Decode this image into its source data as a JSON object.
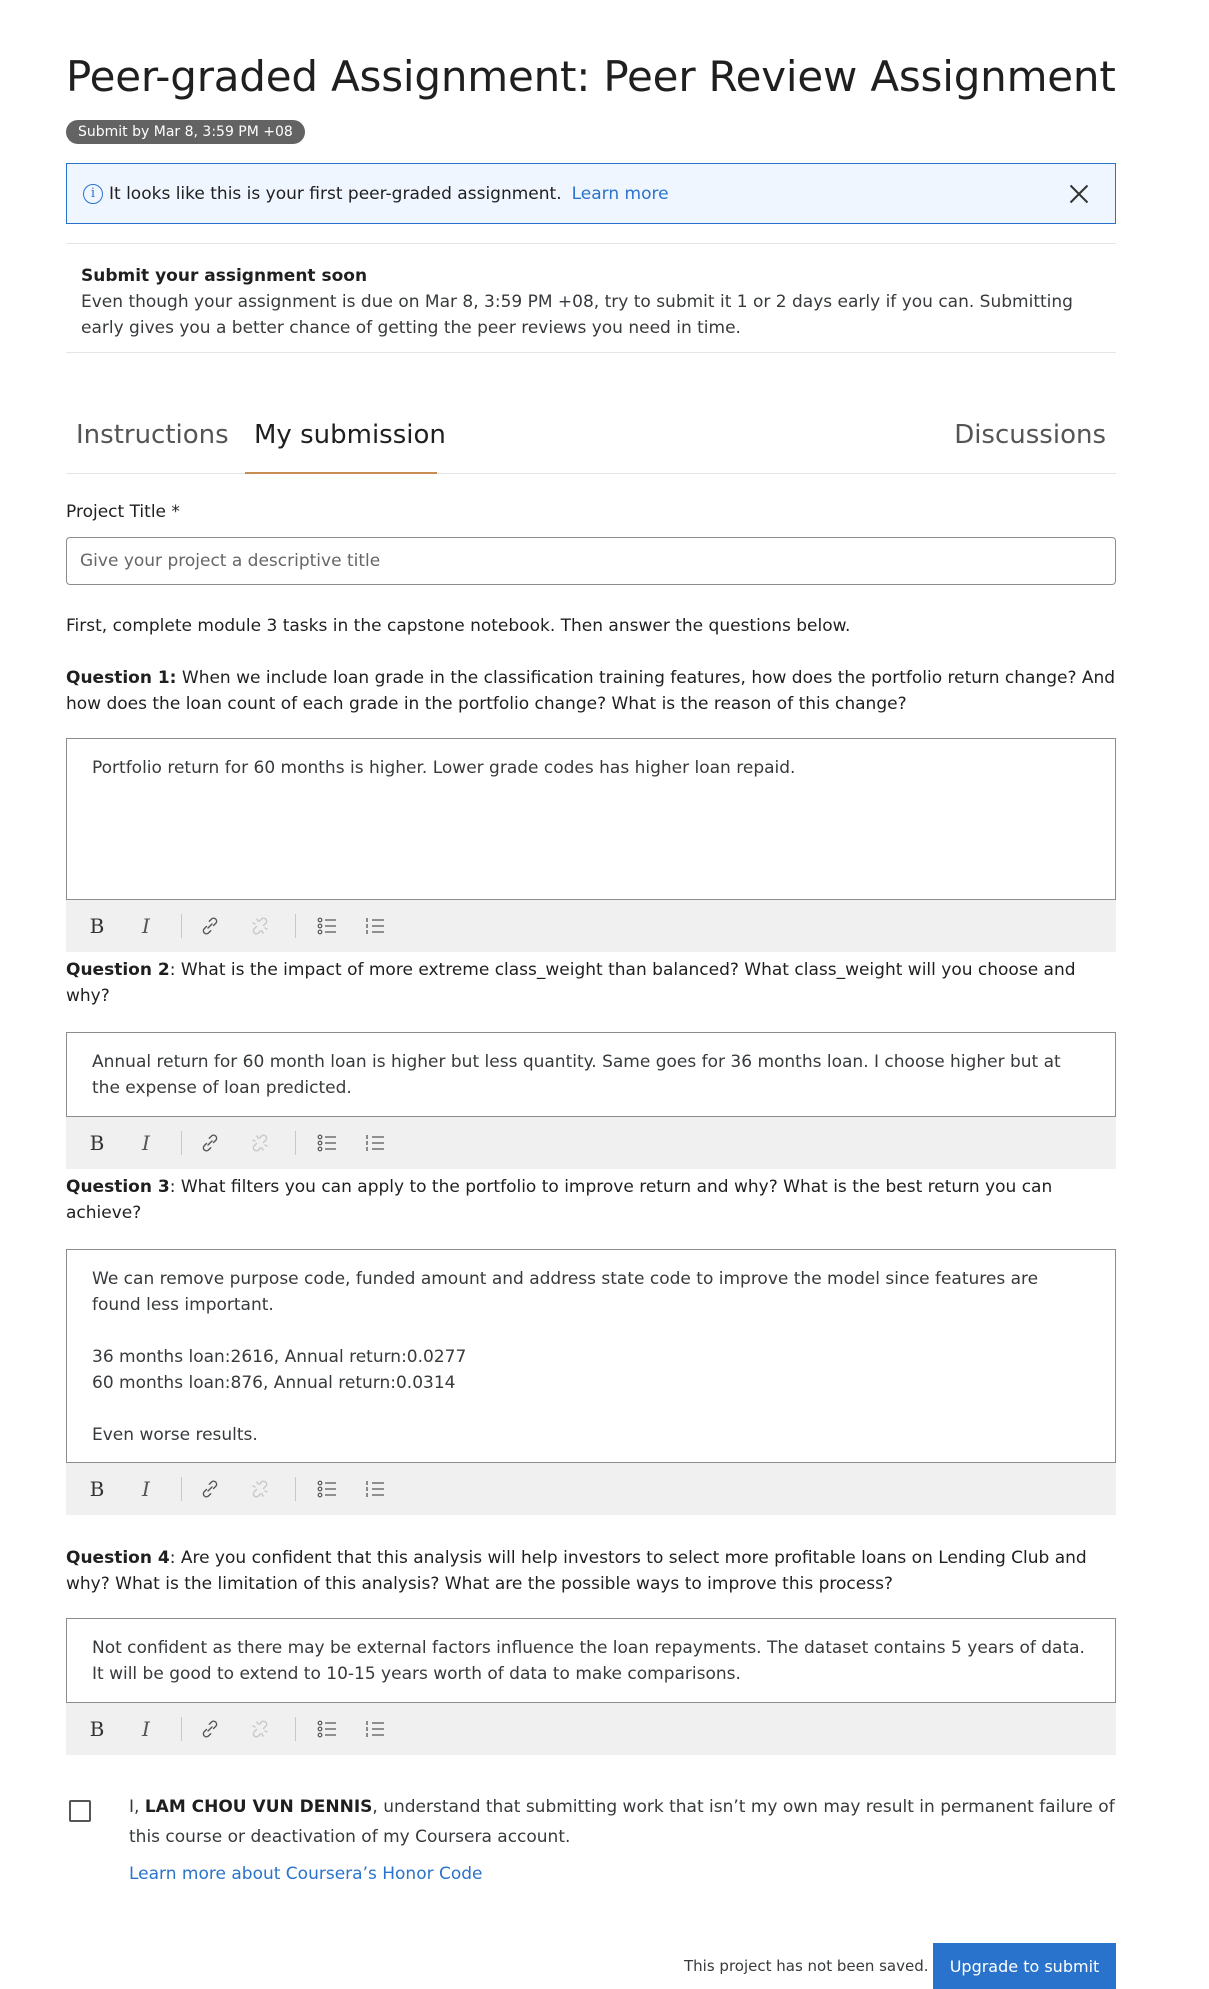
{
  "header": {
    "title": "Peer-graded Assignment: Peer Review Assignment",
    "due_badge": "Submit by Mar 8, 3:59 PM +08"
  },
  "info_banner": {
    "icon": "info-icon",
    "text": "It looks like this is your first peer-graded assignment.",
    "link": "Learn more",
    "close_icon": "close-icon"
  },
  "notice": {
    "title": "Submit your assignment soon",
    "body": "Even though your assignment is due on Mar 8, 3:59 PM +08, try to submit it 1 or 2 days early if you can. Submitting early gives you a better chance of getting the peer reviews you need in time."
  },
  "tabs": [
    {
      "label": "Instructions",
      "active": false
    },
    {
      "label": "My submission",
      "active": true
    },
    {
      "label": "Discussions",
      "active": false
    }
  ],
  "project_title": {
    "label": "Project Title *",
    "placeholder": "Give your project a descriptive title",
    "value": ""
  },
  "intro": "First, complete module 3 tasks in the capstone notebook. Then answer the questions below.",
  "questions": [
    {
      "label": "Question 1:",
      "text": " When we include loan grade in the classification training features, how does the portfolio return change? And how does the loan count of each grade in the portfolio change? What is the reason of this change?",
      "answer": "Portfolio return for 60 months is higher. Lower grade codes has higher loan repaid."
    },
    {
      "label": "Question 2",
      "text": ": What is the impact of more extreme class_weight than balanced? What class_weight will you choose and why?",
      "answer": "Annual return for 60 month loan is higher but less quantity. Same goes for 36 months loan. I choose higher but at the expense of loan predicted."
    },
    {
      "label": "Question 3",
      "text": ": What filters you can apply to the portfolio to improve return and why? What is the best return you can achieve?",
      "answer": "We can remove purpose code, funded amount and address state code to improve the model since features are found less important.\n\n36 months loan:2616, Annual return:0.0277\n60 months loan:876, Annual return:0.0314\n\nEven worse results."
    },
    {
      "label": "Question 4",
      "text": ": Are you confident that this analysis will help investors to select more profitable loans on Lending Club and why? What is the limitation of this analysis? What are the possible ways to improve this process?",
      "answer": "Not confident as there may be external factors influence the loan repayments. The dataset contains 5 years of data. It will be good to extend to 10-15 years worth of data to make comparisons."
    }
  ],
  "toolbar": {
    "bold": "B",
    "italic": "I",
    "icons": [
      "bold-icon",
      "italic-icon",
      "link-icon",
      "unlink-icon",
      "bulleted-list-icon",
      "numbered-list-icon"
    ]
  },
  "honor": {
    "prefix": "I, ",
    "name": "LAM CHOU VUN DENNIS",
    "suffix": ", understand that submitting work that isn’t my own may result in permanent failure of this course or deactivation of my Coursera account.",
    "link": "Learn more about Coursera’s Honor Code",
    "checked": false
  },
  "footer": {
    "status": "This project has not been saved.",
    "submit_label": "Upgrade to submit"
  },
  "colors": {
    "accent": "#2a73cc",
    "tab_underline": "#c88c52",
    "badge_bg": "#636363",
    "toolbar_bg": "#f0f0f0"
  }
}
